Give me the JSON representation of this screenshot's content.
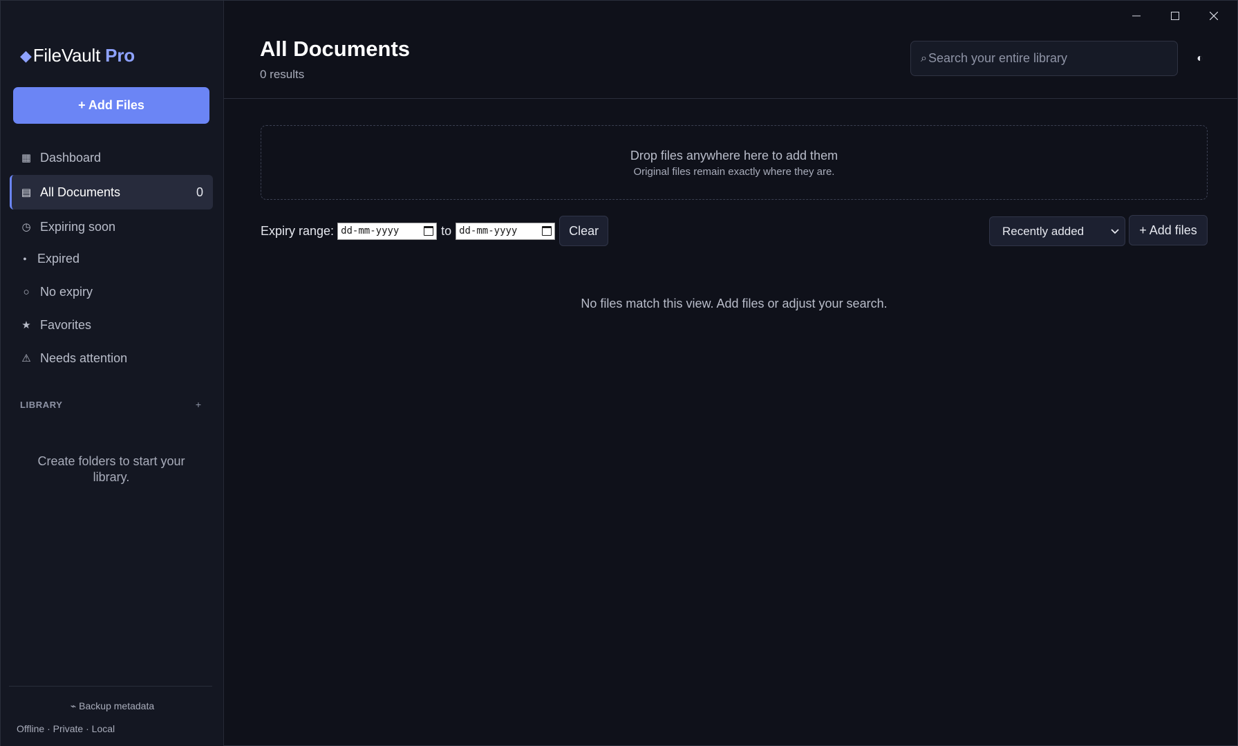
{
  "app": {
    "brand_name": "FileVault",
    "brand_suffix": "Pro",
    "diamond": "◆"
  },
  "colors": {
    "accent": "#6b85f5",
    "background": "#0f111a",
    "sidebar": "#141722"
  },
  "sidebar": {
    "add_button_label": "+ Add Files",
    "items": [
      {
        "label": "Dashboard",
        "icon": "grid-icon",
        "glyph": "▦"
      },
      {
        "label": "All Documents",
        "icon": "list-icon",
        "glyph": "▤",
        "count": "0"
      },
      {
        "label": "Expiring soon",
        "icon": "clock-icon",
        "glyph": "◷"
      },
      {
        "label": "Expired",
        "icon": "dot-icon",
        "glyph": "●"
      },
      {
        "label": "No expiry",
        "icon": "circle-icon",
        "glyph": "○"
      },
      {
        "label": "Favorites",
        "icon": "star-icon",
        "glyph": "★"
      },
      {
        "label": "Needs attention",
        "icon": "warning-icon",
        "glyph": "⚠"
      }
    ],
    "library_label": "LIBRARY",
    "library_add": "+",
    "library_empty": "Create folders to start your library.",
    "backup_label": "⌁ Backup metadata",
    "status": "Offline · Private · Local"
  },
  "header": {
    "title": "All Documents",
    "result_count": "0 results",
    "search_icon": "⌕",
    "search_placeholder": "Search your entire library",
    "theme_toggle": "◐"
  },
  "dropzone": {
    "title": "Drop files anywhere here to add them",
    "subtitle": "Original files remain exactly where they are."
  },
  "filters": {
    "expiry_label": "Expiry range:",
    "date_placeholder_from": "dd-mm-yyyy",
    "to_label": "to",
    "date_placeholder_to": "dd-mm-yyyy",
    "clear_label": "Clear",
    "sort_selected": "Recently added",
    "add_files_label": "+ Add files"
  },
  "empty_state": "No files match this view. Add files or adjust your search."
}
